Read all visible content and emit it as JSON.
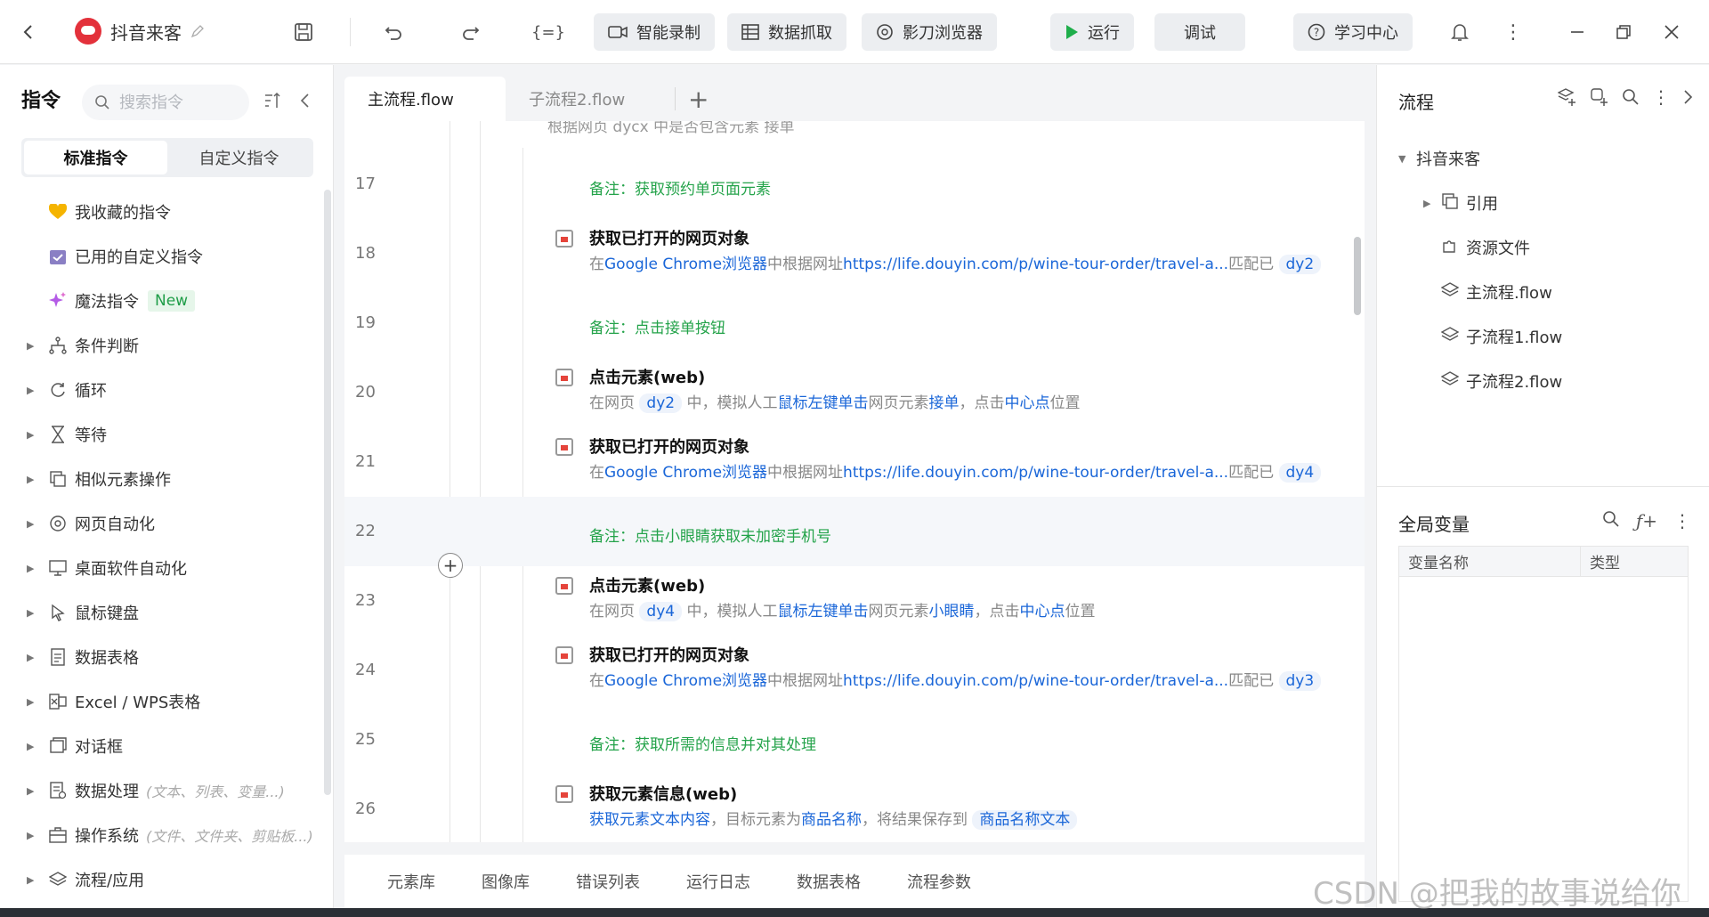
{
  "topbar": {
    "app_title": "抖音来客",
    "buttons": {
      "record": "智能录制",
      "scrape": "数据抓取",
      "browser": "影刀浏览器",
      "run": "运行",
      "debug": "调试",
      "learn": "学习中心"
    }
  },
  "left_panel": {
    "title": "指令",
    "search_placeholder": "搜索指令",
    "segments": [
      "标准指令",
      "自定义指令"
    ],
    "items": [
      {
        "label": "我收藏的指令",
        "icon": "heart-icon",
        "hint": "",
        "badge": ""
      },
      {
        "label": "已用的自定义指令",
        "icon": "calendar-icon",
        "hint": "",
        "badge": ""
      },
      {
        "label": "魔法指令",
        "icon": "sparkle-icon",
        "hint": "",
        "badge": "New"
      },
      {
        "label": "条件判断",
        "icon": "branch-icon",
        "hint": "",
        "badge": ""
      },
      {
        "label": "循环",
        "icon": "loop-icon",
        "hint": "",
        "badge": ""
      },
      {
        "label": "等待",
        "icon": "hourglass-icon",
        "hint": "",
        "badge": ""
      },
      {
        "label": "相似元素操作",
        "icon": "copy-icon",
        "hint": "",
        "badge": ""
      },
      {
        "label": "网页自动化",
        "icon": "browser-icon",
        "hint": "",
        "badge": ""
      },
      {
        "label": "桌面软件自动化",
        "icon": "monitor-icon",
        "hint": "",
        "badge": ""
      },
      {
        "label": "鼠标键盘",
        "icon": "cursor-icon",
        "hint": "",
        "badge": ""
      },
      {
        "label": "数据表格",
        "icon": "document-icon",
        "hint": "",
        "badge": ""
      },
      {
        "label": "Excel / WPS表格",
        "icon": "excel-icon",
        "hint": "",
        "badge": ""
      },
      {
        "label": "对话框",
        "icon": "dialog-icon",
        "hint": "",
        "badge": ""
      },
      {
        "label": "数据处理",
        "icon": "data-icon",
        "hint": "(文本、列表、变量...)",
        "badge": ""
      },
      {
        "label": "操作系统",
        "icon": "briefcase-icon",
        "hint": "(文件、文件夹、剪贴板...)",
        "badge": ""
      },
      {
        "label": "流程/应用",
        "icon": "layers-icon",
        "hint": "",
        "badge": ""
      }
    ]
  },
  "tabs": [
    "主流程.flow",
    "子流程2.flow"
  ],
  "editor": {
    "cut_row": "根据网页 dycx 中是否包含元素 接单",
    "rows": [
      {
        "num": "17",
        "type": "note",
        "note": "备注：获取预约单页面元素"
      },
      {
        "num": "18",
        "type": "cmd",
        "title": "获取已打开的网页对象",
        "p1": "在",
        "b1": "Google Chrome浏览器",
        "p2": "中根据网址",
        "b2": "https://life.douyin.com/p/wine-tour-order/travel-a...",
        "p3": "匹配已",
        "v": "dy2"
      },
      {
        "num": "19",
        "type": "note",
        "note": "备注：点击接单按钮"
      },
      {
        "num": "20",
        "type": "cmd",
        "title": "点击元素(web)",
        "p0": "在网页",
        "v": "dy2",
        "p1": "中，模拟人工",
        "b1": "鼠标左键单击",
        "p2": "网页元素",
        "b2": "接单",
        "p3": "，点击",
        "b3": "中心点",
        "p4": "位置"
      },
      {
        "num": "21",
        "type": "cmd",
        "title": "获取已打开的网页对象",
        "p1": "在",
        "b1": "Google Chrome浏览器",
        "p2": "中根据网址",
        "b2": "https://life.douyin.com/p/wine-tour-order/travel-a...",
        "p3": "匹配已",
        "v": "dy4"
      },
      {
        "num": "22",
        "type": "note",
        "note": "备注：点击小眼睛获取未加密手机号"
      },
      {
        "num": "23",
        "type": "cmd",
        "title": "点击元素(web)",
        "p0": "在网页",
        "v": "dy4",
        "p1": "中，模拟人工",
        "b1": "鼠标左键单击",
        "p2": "网页元素",
        "b2": "小眼睛",
        "p3": "，点击",
        "b3": "中心点",
        "p4": "位置"
      },
      {
        "num": "24",
        "type": "cmd",
        "title": "获取已打开的网页对象",
        "p1": "在",
        "b1": "Google Chrome浏览器",
        "p2": "中根据网址",
        "b2": "https://life.douyin.com/p/wine-tour-order/travel-a...",
        "p3": "匹配已",
        "v": "dy3"
      },
      {
        "num": "25",
        "type": "note",
        "note": "备注：获取所需的信息并对其处理"
      },
      {
        "num": "26",
        "type": "cmd",
        "title": "获取元素信息(web)",
        "b1": "获取元素文本内容",
        "p1": "，目标元素为",
        "b2": "商品名称",
        "p2": "，将结果保存到",
        "v": "商品名称文本"
      }
    ]
  },
  "bottom_tabs": [
    "元素库",
    "图像库",
    "错误列表",
    "运行日志",
    "数据表格",
    "流程参数"
  ],
  "right_panel": {
    "title": "流程",
    "tree_root": "抖音来客",
    "tree": [
      "引用",
      "资源文件",
      "主流程.flow",
      "子流程1.flow",
      "子流程2.flow"
    ],
    "globals_title": "全局变量",
    "columns": [
      "变量名称",
      "类型"
    ]
  },
  "watermark": "CSDN @把我的故事说给你"
}
